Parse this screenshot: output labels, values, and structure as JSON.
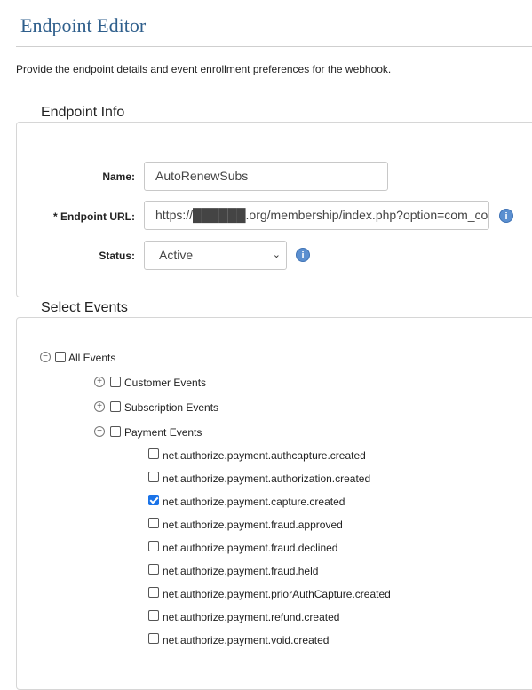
{
  "header": {
    "title": "Endpoint Editor",
    "intro": "Provide the endpoint details and event enrollment preferences for the webhook."
  },
  "endpoint_info": {
    "legend": "Endpoint Info",
    "name_label": "Name:",
    "name_value": "AutoRenewSubs",
    "url_label": "* Endpoint URL:",
    "url_value": "https://██████.org/membership/index.php?option=com_compr",
    "status_label": "Status:",
    "status_value": "Active"
  },
  "select_events": {
    "legend": "Select Events",
    "all_events": "All Events",
    "customer_events": "Customer Events",
    "subscription_events": "Subscription Events",
    "payment_events": "Payment Events",
    "payment_items": [
      {
        "label": "net.authorize.payment.authcapture.created",
        "checked": false
      },
      {
        "label": "net.authorize.payment.authorization.created",
        "checked": false
      },
      {
        "label": "net.authorize.payment.capture.created",
        "checked": true
      },
      {
        "label": "net.authorize.payment.fraud.approved",
        "checked": false
      },
      {
        "label": "net.authorize.payment.fraud.declined",
        "checked": false
      },
      {
        "label": "net.authorize.payment.fraud.held",
        "checked": false
      },
      {
        "label": "net.authorize.payment.priorAuthCapture.created",
        "checked": false
      },
      {
        "label": "net.authorize.payment.refund.created",
        "checked": false
      },
      {
        "label": "net.authorize.payment.void.created",
        "checked": false
      }
    ]
  },
  "colors": {
    "title": "#2f5f8c",
    "info_icon": "#5b8fd0",
    "checkbox_checked": "#1a73e8"
  }
}
